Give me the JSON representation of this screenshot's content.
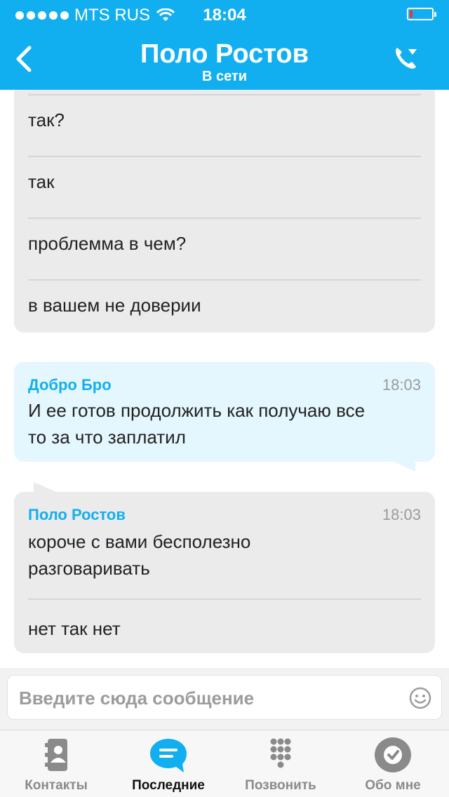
{
  "status_bar": {
    "carrier": "MTS RUS",
    "time": "18:04"
  },
  "header": {
    "title": "Поло Ростов",
    "subtitle": "В сети"
  },
  "messages": {
    "group1": [
      "так?",
      "так",
      "проблемма в чем?",
      "в вашем не доверии"
    ],
    "bubble2": {
      "sender": "Добро Бро",
      "time": "18:03",
      "text": [
        "И ее готов продолжить как получаю все",
        "то за что заплатил"
      ]
    },
    "bubble3": {
      "sender": "Поло Ростов",
      "time": "18:03",
      "text": [
        "короче с вами бесполезно",
        "разговаривать"
      ],
      "extra": "нет так нет"
    }
  },
  "input": {
    "placeholder": "Введите сюда сообщение"
  },
  "tabs": [
    {
      "label": "Контакты",
      "icon": "contacts-icon",
      "active": false
    },
    {
      "label": "Последние",
      "icon": "chat-bubble-icon",
      "active": true
    },
    {
      "label": "Позвонить",
      "icon": "dialpad-icon",
      "active": false
    },
    {
      "label": "Обо мне",
      "icon": "profile-check-icon",
      "active": false
    }
  ],
  "colors": {
    "accent": "#12aff0",
    "bubble_other": "#ebebeb",
    "bubble_self": "#e4f6fe"
  }
}
